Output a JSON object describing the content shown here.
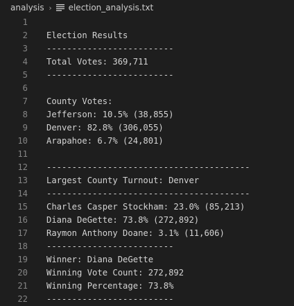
{
  "breadcrumb": {
    "folder": "analysis",
    "separator": "›",
    "file": "election_analysis.txt",
    "file_icon": "text-file-icon"
  },
  "lines": [
    {
      "n": "1",
      "text": ""
    },
    {
      "n": "2",
      "text": "Election Results"
    },
    {
      "n": "3",
      "text": "-------------------------"
    },
    {
      "n": "4",
      "text": "Total Votes: 369,711"
    },
    {
      "n": "5",
      "text": "-------------------------"
    },
    {
      "n": "6",
      "text": ""
    },
    {
      "n": "7",
      "text": "County Votes:"
    },
    {
      "n": "8",
      "text": "Jefferson: 10.5% (38,855)"
    },
    {
      "n": "9",
      "text": "Denver: 82.8% (306,055)"
    },
    {
      "n": "10",
      "text": "Arapahoe: 6.7% (24,801)"
    },
    {
      "n": "11",
      "text": ""
    },
    {
      "n": "12",
      "text": "----------------------------------------"
    },
    {
      "n": "13",
      "text": "Largest County Turnout: Denver"
    },
    {
      "n": "14",
      "text": "----------------------------------------"
    },
    {
      "n": "15",
      "text": "Charles Casper Stockham: 23.0% (85,213)"
    },
    {
      "n": "16",
      "text": "Diana DeGette: 73.8% (272,892)"
    },
    {
      "n": "17",
      "text": "Raymon Anthony Doane: 3.1% (11,606)"
    },
    {
      "n": "18",
      "text": "-------------------------"
    },
    {
      "n": "19",
      "text": "Winner: Diana DeGette"
    },
    {
      "n": "20",
      "text": "Winning Vote Count: 272,892"
    },
    {
      "n": "21",
      "text": "Winning Percentage: 73.8%"
    },
    {
      "n": "22",
      "text": "-------------------------"
    }
  ],
  "colors": {
    "background": "#1e1e1e",
    "text": "#d4d4d4",
    "line_number": "#858585",
    "breadcrumb": "#cccccc"
  }
}
